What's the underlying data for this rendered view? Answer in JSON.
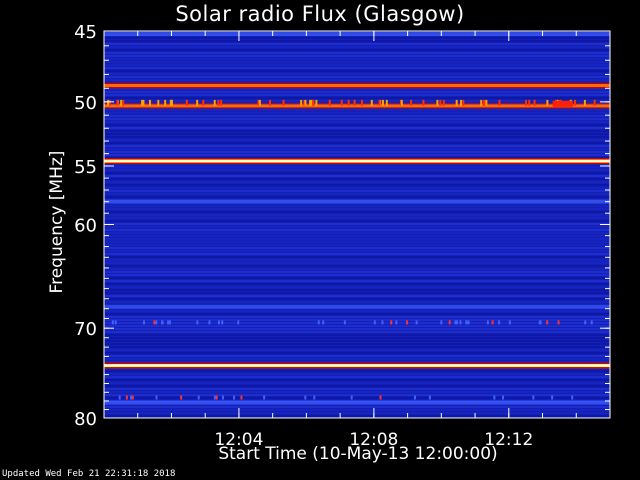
{
  "chart_data": {
    "type": "heatmap",
    "title": "Solar radio Flux (Glasgow)",
    "xlabel": "Start Time (10-May-13 12:00:00)",
    "ylabel": "Frequency [MHz]",
    "x_range_minutes": [
      0,
      15.0
    ],
    "x_ticks": [
      {
        "minutes": 4,
        "label": "12:04"
      },
      {
        "minutes": 8,
        "label": "12:08"
      },
      {
        "minutes": 12,
        "label": "12:12"
      }
    ],
    "y_range_mhz": [
      45,
      80
    ],
    "y_scale": "log",
    "y_ticks": [
      {
        "mhz": 45,
        "label": "45"
      },
      {
        "mhz": 50,
        "label": "50"
      },
      {
        "mhz": 55,
        "label": "55"
      },
      {
        "mhz": 60,
        "label": "60"
      },
      {
        "mhz": 70,
        "label": "70"
      },
      {
        "mhz": 80,
        "label": "80"
      }
    ],
    "colormap": [
      "#000040",
      "#0000c0",
      "#2030ff",
      "#c00000",
      "#ff4000",
      "#ffff60",
      "#ffffff"
    ],
    "background_color": "#1420b4",
    "bright_bands": [
      {
        "mhz": 48.8,
        "intensity": 0.75
      },
      {
        "mhz": 50.3,
        "intensity": 0.6
      },
      {
        "mhz": 54.6,
        "intensity": 1.0
      },
      {
        "mhz": 74.0,
        "intensity": 1.0
      }
    ],
    "weak_bands": [
      {
        "mhz": 45.2,
        "intensity": 0.3
      },
      {
        "mhz": 58.0,
        "intensity": 0.35
      },
      {
        "mhz": 67.8,
        "intensity": 0.3
      },
      {
        "mhz": 78.2,
        "intensity": 0.4
      }
    ]
  },
  "footer": {
    "updated": "Updated Wed Feb 21 22:31:18 2018"
  }
}
